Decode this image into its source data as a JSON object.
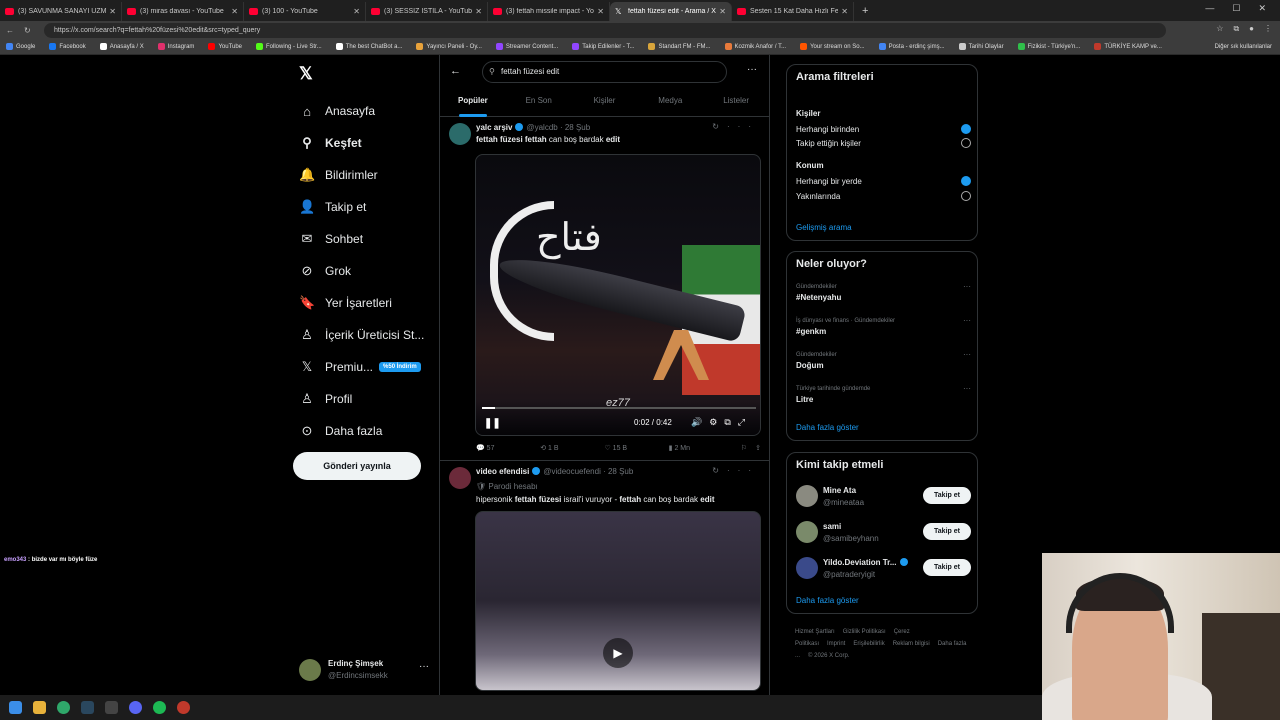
{
  "browser": {
    "tabs": [
      {
        "title": "(3) SAVUNMA SANAYİ UZMANI, İl",
        "icon": "youtube-icon",
        "active": false
      },
      {
        "title": "(3) miras davası - YouTube",
        "icon": "youtube-icon",
        "active": false
      },
      {
        "title": "(3) 100 - YouTube",
        "icon": "youtube-icon",
        "active": false
      },
      {
        "title": "(3) SESSİZ İSTİLA - YouTube",
        "icon": "youtube-icon",
        "active": false
      },
      {
        "title": "(3) fettah missile impact - YouTube",
        "icon": "youtube-icon",
        "active": false
      },
      {
        "title": "fettah füzesi edit - Arama / X",
        "icon": "x-icon",
        "active": true
      },
      {
        "title": "Sesten 15 Kat Daha Hızlı Fettah H...",
        "icon": "youtube-icon",
        "active": false
      }
    ],
    "url": "https://x.com/search?q=fettah%20füzesi%20edit&src=typed_query",
    "bookmarks": [
      "Google",
      "Facebook",
      "Anasayfa / X",
      "Instagram",
      "YouTube",
      "Following - Live Str...",
      "The best ChatBot a...",
      "Yayıncı Paneli - Oy...",
      "Streamer Content...",
      "Takip Edilenler - T...",
      "Standart FM - FM...",
      "Kozmik Anafor / T...",
      "Your stream on So...",
      "Posta - erdinç şimş...",
      "Tarihi Olaylar",
      "Fizikist - Türkiye'n...",
      "TÜRKİYE KAMP ve..."
    ],
    "bookmarks_other": "Diğer sık kullanılanlar"
  },
  "nav": {
    "items": [
      {
        "label": "Anasayfa",
        "icon": "home-icon",
        "glyph": "⌂"
      },
      {
        "label": "Keşfet",
        "icon": "search-icon",
        "glyph": "⚲",
        "bold": true
      },
      {
        "label": "Bildirimler",
        "icon": "bell-icon",
        "glyph": "🔔"
      },
      {
        "label": "Takip et",
        "icon": "follow-icon",
        "glyph": "👤"
      },
      {
        "label": "Sohbet",
        "icon": "mail-icon",
        "glyph": "✉"
      },
      {
        "label": "Grok",
        "icon": "grok-icon",
        "glyph": "⊘"
      },
      {
        "label": "Yer İşaretleri",
        "icon": "bookmark-icon",
        "glyph": "🔖"
      },
      {
        "label": "İçerik Üreticisi St...",
        "icon": "creator-icon",
        "glyph": "♙"
      },
      {
        "label": "Premiu...",
        "icon": "x-premium-icon",
        "glyph": "𝕏",
        "badge": "%50 İndirim"
      },
      {
        "label": "Profil",
        "icon": "profile-icon",
        "glyph": "♙"
      },
      {
        "label": "Daha fazla",
        "icon": "more-icon",
        "glyph": "⊙"
      }
    ],
    "post_button": "Gönderi yayınla",
    "account": {
      "name": "Erdinç Şimşek",
      "handle": "@Erdincsimsekk"
    }
  },
  "chat_overlay": {
    "user": "emo343",
    "message": ": bizde var mı böyle füze"
  },
  "search": {
    "query": "fettah füzesi edit"
  },
  "tabs": [
    "Popüler",
    "En Son",
    "Kişiler",
    "Medya",
    "Listeler"
  ],
  "tweets": [
    {
      "name": "yalc arşiv",
      "handle": "@yalcdb",
      "date": "28 Şub",
      "text_parts": [
        {
          "t": "fettah füzesi fettah",
          "b": true
        },
        {
          "t": " can boş bardak ",
          "b": false
        },
        {
          "t": "edit",
          "b": true
        }
      ],
      "video": {
        "time": "0:02 / 0:42",
        "progress": 0.048,
        "overlay_text": "فتاح",
        "watermark": "ez77"
      },
      "stats": {
        "replies": "57",
        "reposts": "1 B",
        "likes": "15 B",
        "views": "2 Mn"
      }
    },
    {
      "name": "video efendisi",
      "handle": "@videocuefendi",
      "date": "28 Şub",
      "label": "Parodi hesabı",
      "text_parts": [
        {
          "t": "hipersonik ",
          "b": false
        },
        {
          "t": "fettah füzesi",
          "b": true
        },
        {
          "t": " israil'i vuruyor - ",
          "b": false
        },
        {
          "t": "fettah",
          "b": true
        },
        {
          "t": " can boş bardak ",
          "b": false
        },
        {
          "t": "edit",
          "b": true
        }
      ]
    }
  ],
  "filters": {
    "title": "Arama filtreleri",
    "people_label": "Kişiler",
    "people_options": [
      {
        "label": "Herhangi birinden",
        "selected": true
      },
      {
        "label": "Takip ettiğin kişiler",
        "selected": false
      }
    ],
    "location_label": "Konum",
    "location_options": [
      {
        "label": "Herhangi bir yerde",
        "selected": true
      },
      {
        "label": "Yakınlarında",
        "selected": false
      }
    ],
    "advanced": "Gelişmiş arama"
  },
  "trends": {
    "title": "Neler oluyor?",
    "items": [
      {
        "category": "Gündemdekiler",
        "tag": "#Netenyahu"
      },
      {
        "category": "İş dünyası ve finans · Gündemdekiler",
        "tag": "#genkm"
      },
      {
        "category": "Gündemdekiler",
        "tag": "Doğum"
      },
      {
        "category": "Türkiye tarihinde gündemde",
        "tag": "Litre"
      }
    ],
    "more": "Daha fazla göster"
  },
  "who_to_follow": {
    "title": "Kimi takip etmeli",
    "items": [
      {
        "name": "Mine Ata",
        "handle": "@mineataa",
        "verified": false
      },
      {
        "name": "sami",
        "handle": "@samibeyhann",
        "verified": false
      },
      {
        "name": "Yildo.Deviation Tr...",
        "handle": "@patraderyigit",
        "verified": true
      }
    ],
    "follow_label": "Takip et",
    "more": "Daha fazla göster"
  },
  "footer": [
    "Hizmet Şartları",
    "Gizlilik Politikası",
    "Çerez Politikası",
    "Imprint",
    "Erişilebilirlik",
    "Reklam bilgisi",
    "Daha fazla ...",
    "© 2026 X Corp."
  ],
  "colors": {
    "accent": "#1d9bf0",
    "bg": "#000000",
    "border": "#2f3336",
    "muted": "#71767b"
  }
}
